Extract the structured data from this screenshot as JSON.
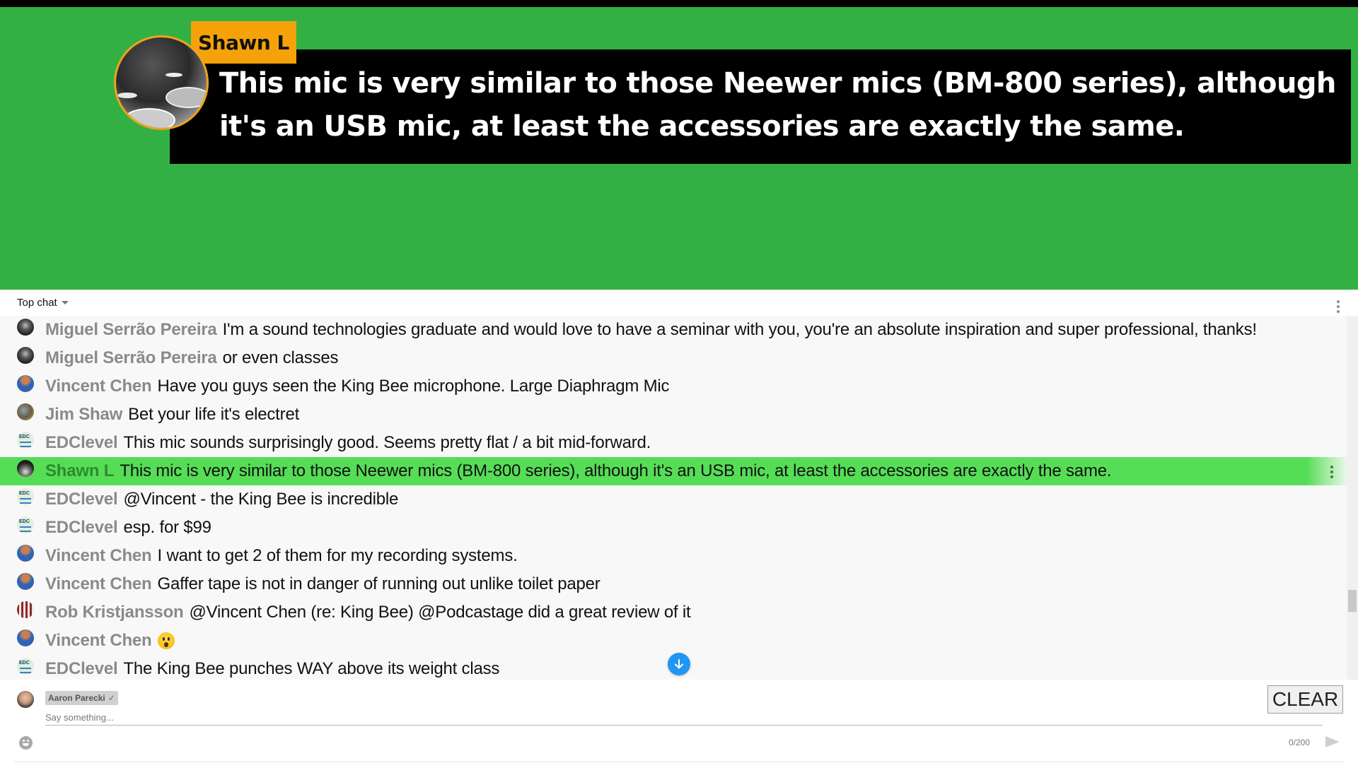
{
  "overlay": {
    "author": "Shawn L",
    "message": "This mic is very similar to those Neewer mics (BM-800 series), although it's an USB mic, at least the accessories are exactly the same.",
    "colors": {
      "background": "#33b044",
      "name_tag": "#f5a20a",
      "box": "#000000"
    }
  },
  "chat": {
    "mode_label": "Top chat",
    "messages": [
      {
        "author": "Miguel Serrão Pereira",
        "text": "I'm a sound technologies graduate and would love to have a seminar with you, you're an absolute inspiration and super professional, thanks!"
      },
      {
        "author": "Miguel Serrão Pereira",
        "text": "or even classes"
      },
      {
        "author": "Vincent Chen",
        "text": "Have you guys seen the King Bee microphone. Large Diaphragm Mic"
      },
      {
        "author": "Jim Shaw",
        "text": "Bet your life it's electret"
      },
      {
        "author": "EDClevel",
        "text": "This mic sounds surprisingly good. Seems pretty flat / a bit mid-forward."
      },
      {
        "author": "Shawn L",
        "text": "This mic is very similar to those Neewer mics (BM-800 series), although it's an USB mic, at least the accessories are exactly the same.",
        "highlighted": true
      },
      {
        "author": "EDClevel",
        "text": "@Vincent - the King Bee is incredible"
      },
      {
        "author": "EDClevel",
        "text": "esp. for $99"
      },
      {
        "author": "Vincent Chen",
        "text": "I want to get 2 of them for my recording systems."
      },
      {
        "author": "Vincent Chen",
        "text": "Gaffer tape is not in danger of running out unlike toilet paper"
      },
      {
        "author": "Rob Kristjansson",
        "text": "@Vincent Chen (re: King Bee) @Podcastage did a great review of it"
      },
      {
        "author": "Vincent Chen",
        "text": "",
        "emoji": "astonished-face"
      },
      {
        "author": "EDClevel",
        "text": "The King Bee punches WAY above its weight class"
      }
    ],
    "highlight_color": "#56dd56",
    "jump_button_icon": "arrow-down-icon",
    "jump_button_color": "#2196f3"
  },
  "composer": {
    "user_name": "Aaron Parecki",
    "verified_mark": "✓",
    "placeholder": "Say something...",
    "value": "",
    "clear_label": "CLEAR",
    "counter": "0/200"
  }
}
